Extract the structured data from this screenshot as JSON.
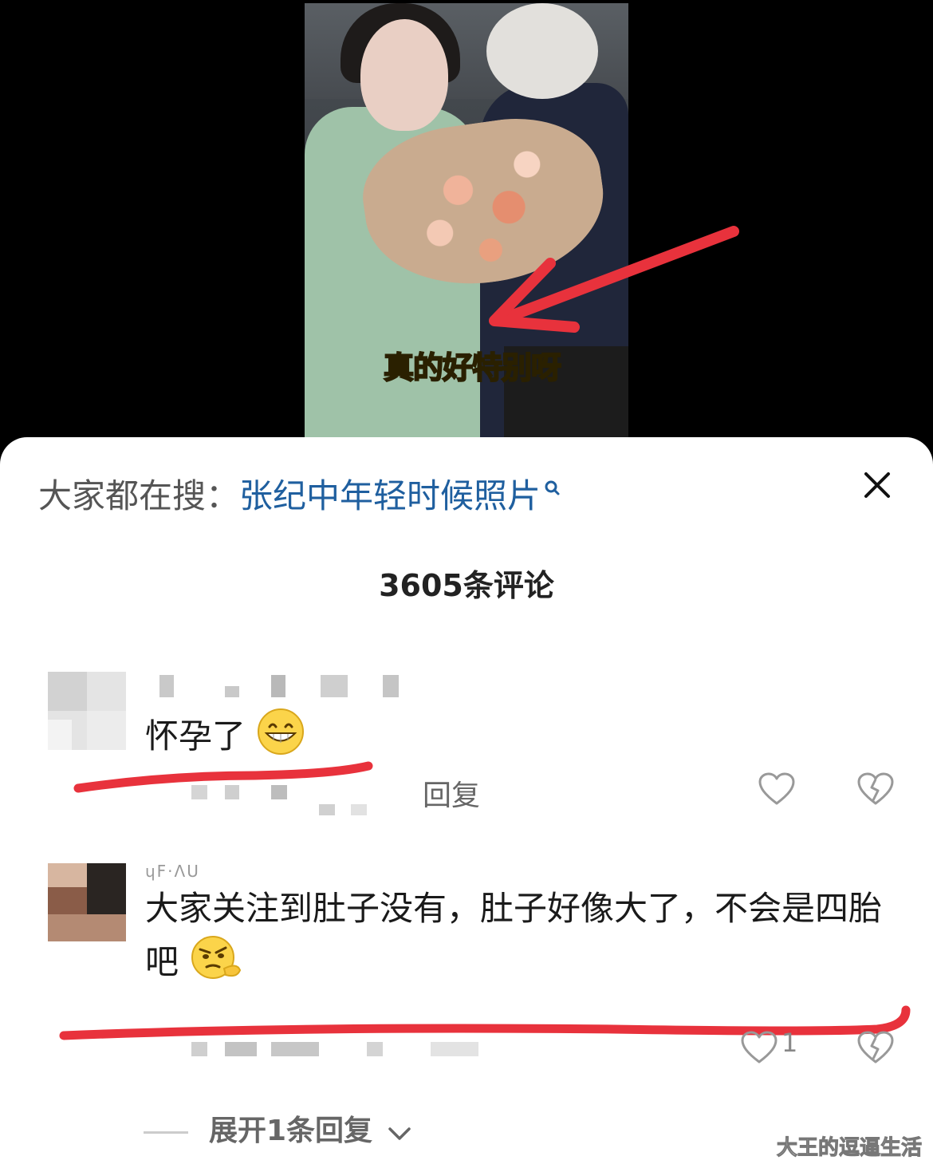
{
  "video": {
    "caption": "真的好特别呀"
  },
  "search": {
    "prefix": "大家都在搜：",
    "term": "张纪中年轻时候照片"
  },
  "comments_header": {
    "count_label": "3605条评论"
  },
  "comments": [
    {
      "text": "怀孕了",
      "emoji": "grin-emoji",
      "reply_label": "回复"
    },
    {
      "username": "ɥF·ɅU",
      "text": "大家关注到肚子没有，肚子好像大了，不会是四胎吧",
      "emoji": "smirk-thinking-emoji",
      "likes": "1",
      "expand_label": "展开1条回复"
    }
  ],
  "watermark": "大王的逗逼生活",
  "colors": {
    "search_term": "#1f5f9f",
    "annotation_red": "#e8323c",
    "caption_yellow": "#ffe83a"
  }
}
